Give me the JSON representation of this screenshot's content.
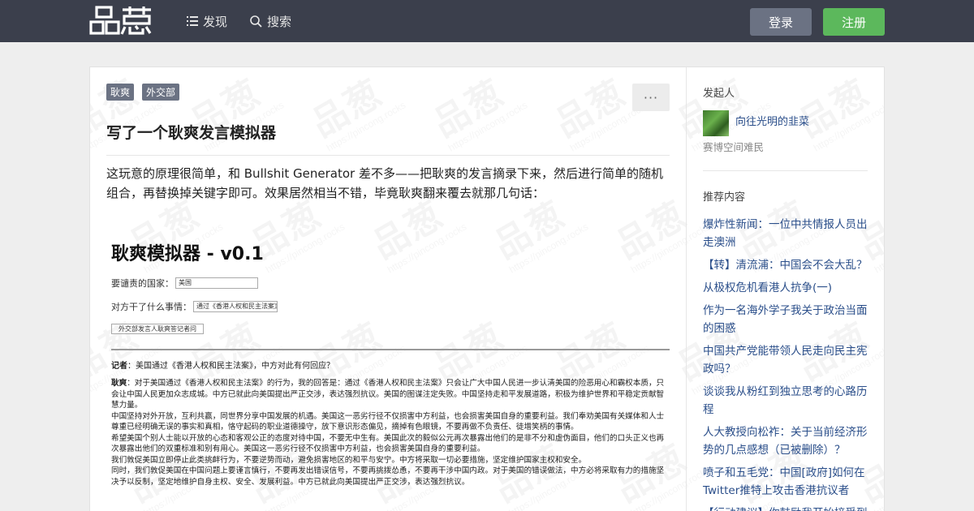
{
  "header": {
    "logo_text": "品葱",
    "nav": [
      {
        "label": "发现",
        "icon": "list-icon"
      },
      {
        "label": "搜索",
        "icon": "search-icon"
      }
    ],
    "login_label": "登录",
    "signup_label": "注册"
  },
  "colors": {
    "topbar": "#3b3f4c",
    "login": "#6b7283",
    "signup": "#5cb85c",
    "link": "#2a4e8a"
  },
  "watermark": {
    "big": "品葱",
    "small": "https://pincong.rocks"
  },
  "post": {
    "tags": [
      "耿爽",
      "外交部"
    ],
    "more_label": "···",
    "title": "写了一个耿爽发言模拟器",
    "intro": "这玩意的原理很简单，和 Bullshit Generator 差不多——把耿爽的发言摘录下来，然后进行简单的随机组合，再替换掉关键字即可。效果居然相当不错，毕竟耿爽翻来覆去就那几句话：",
    "screenshot": {
      "title": "耿爽模拟器 - v0.1",
      "country_label": "要谴责的国家：",
      "country_value": "美国",
      "action_label": "对方干了什么事情：",
      "action_value": "通过《香港人权和民主法案》",
      "button_label": "外交部发言人耿爽答记者问",
      "question_label": "记者",
      "question_text": "：美国通过《香港人权和民主法案》，中方对此有何回应？",
      "answer_label": "耿爽",
      "answer_text": "：对于美国通过《香港人权和民主法案》的行为，我的回答是：通过《香港人权和民主法案》只会让广大中国人民进一步认清美国的险恶用心和霸权本质，只会让中国人民更加众志成城。中方已就此向美国提出严正交涉，表达强烈抗议。美国的图谋注定失败。中国坚持走和平发展道路，积极为维护世界和平稳定贡献智慧力量。",
      "answer_paragraphs": [
        "中国坚持对外开放，互利共赢，同世界分享中国发展的机遇。美国这一恶劣行径不仅损害中方利益，也会损害美国自身的重要利益。我们奉劝美国有关媒体和人士尊重已经明确无误的事实和真相，恪守起码的职业道德操守，放下意识形态偏见，摘掉有色眼镜，不要再做不负责任、徒增笑柄的事情。",
        "希望美国个别人士能以开放的心态和客观公正的态度对待中国，不要无中生有。美国此次的毅似公元再次暴露出他们的是非不分和虚伪面目，他们的口头正义也再次暴露出他们的双重标准和别有用心。美国这一恶劣行径不仅损害中方利益，也会损害美国自身的重要利益。",
        "我们敦促美国立即停止此类挑衅行为，不要逆势而动，避免损害地区的和平与安宁。中方将采取一切必要措施，坚定维护国家主权和安全。",
        "同时，我们敦促美国在中国问题上要谨言慎行，不要再发出错误信号，不要再挑拨怂恿，不要再干涉中国内政。对于美国的错误做法，中方必将采取有力的措施坚决予以反制，坚定地维护自身主权、安全、发展利益。中方已就此向美国提出严正交涉，表达强烈抗议。"
      ]
    }
  },
  "sidebar": {
    "author_heading": "发起人",
    "author_name": "向往光明的韭菜",
    "author_bio": "赛博空间难民",
    "recommend_heading": "推荐内容",
    "recommend": [
      "爆炸性新闻：一位中共情报人员出走澳洲",
      "【转】清流浦：中国会不会大乱？",
      "从极权危机看港人抗争(一)",
      "作为一名海外学子我关于政治当面的困惑",
      "中国共产党能带领人民走向民主宪政吗？",
      "谈谈我从粉红到独立思考的心路历程",
      "人大教授向松祚：关于当前经济形势的几点感想（已被删除）？",
      "喷子和五毛党：中国[政府]如何在Twitter推特上攻击香港抗议者",
      "【行动建议】你鼓励我开始接受到"
    ]
  }
}
